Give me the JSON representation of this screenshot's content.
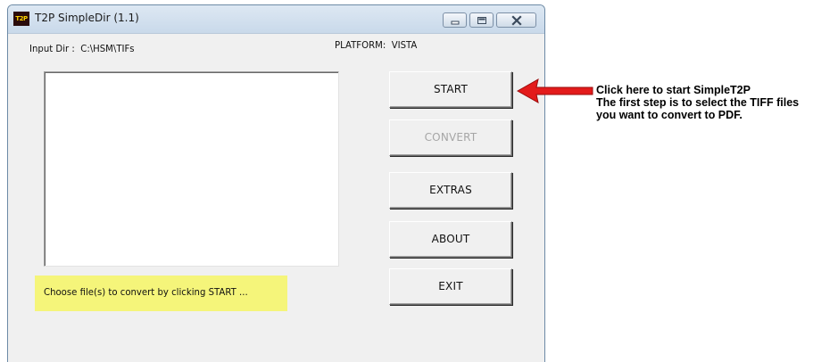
{
  "window": {
    "icon_text": "T2P",
    "title": "T2P SimpleDir (1.1)"
  },
  "info": {
    "input_dir_label": "Input Dir :",
    "input_dir_value": "C:\\HSM\\TIFs",
    "platform_label": "PLATFORM:",
    "platform_value": "VISTA"
  },
  "buttons": {
    "start": "START",
    "convert": "CONVERT",
    "extras": "EXTRAS",
    "about": "ABOUT",
    "exit": "EXIT"
  },
  "status": {
    "message": "Choose file(s) to convert by clicking START ..."
  },
  "annotation": {
    "lines": [
      "Click here to start SimpleT2P",
      "The first step is to select the TIFF files",
      "you want to convert to PDF."
    ],
    "arrow_color": "#e31b1b"
  }
}
